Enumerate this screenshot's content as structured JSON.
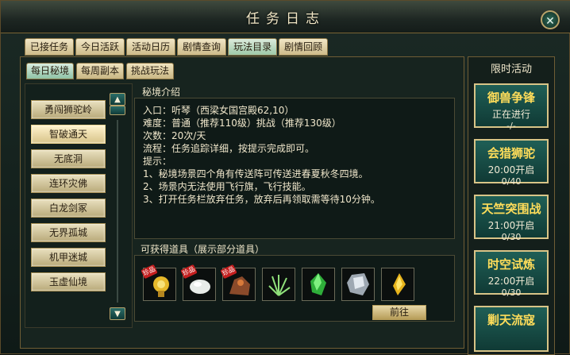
{
  "window": {
    "title": "任务日志",
    "close_glyph": "✕"
  },
  "tabs": [
    "已接任务",
    "今日活跃",
    "活动日历",
    "剧情查询",
    "玩法目录",
    "剧情回顾"
  ],
  "active_tab_index": 4,
  "subtabs": [
    "每日秘境",
    "每周副本",
    "挑战玩法"
  ],
  "active_subtab_index": 0,
  "list_items": [
    "勇闯狮驼岭",
    "智破通天",
    "无底洞",
    "连环灾佛",
    "白龙剑冢",
    "无界孤城",
    "机甲迷城",
    "玉虚仙境"
  ],
  "selected_list_index": 1,
  "scroll": {
    "up_glyph": "▲",
    "down_glyph": "▼"
  },
  "description": {
    "label": "秘境介绍",
    "lines": [
      "入口：听琴（西梁女国宫殿62,10）",
      "难度：普通（推荐110级）挑战（推荐130级）",
      "次数：20次/天",
      "流程：任务追踪详细，按提示完成即可。",
      "提示：",
      "1、秘境场景四个角有传送阵可传送进春夏秋冬四境。",
      "2、场景内无法使用飞行旗，飞行技能。",
      "3、打开任务栏放弃任务，放弃后再领取需等待10分钟。"
    ]
  },
  "items_panel": {
    "label": "可获得道具（展示部分道具）",
    "items": [
      {
        "icon": "golden-pendant-icon",
        "badge": "珍品"
      },
      {
        "icon": "white-pearl-icon",
        "badge": "珍品"
      },
      {
        "icon": "beast-figure-icon",
        "badge": "珍品"
      },
      {
        "icon": "green-herb-icon",
        "badge": ""
      },
      {
        "icon": "green-crystal-icon",
        "badge": ""
      },
      {
        "icon": "silver-ore-icon",
        "badge": ""
      },
      {
        "icon": "yellow-gem-icon",
        "badge": ""
      }
    ],
    "goto_label": "前往"
  },
  "sidebar": {
    "title": "限时活动",
    "events": [
      {
        "name": "御兽争锋",
        "time": "正在进行",
        "count": "-/-"
      },
      {
        "name": "会猎狮驼",
        "time": "20:00开启",
        "count": "0/40"
      },
      {
        "name": "天竺突围战",
        "time": "21:00开启",
        "count": "0/30"
      },
      {
        "name": "时空试炼",
        "time": "22:00开启",
        "count": "0/30"
      },
      {
        "name": "剿天流寇",
        "time": "",
        "count": ""
      }
    ]
  },
  "colors": {
    "accent_gold": "#d8c487",
    "event_name": "#ffdd5a",
    "badge_red": "#c41f1f"
  }
}
